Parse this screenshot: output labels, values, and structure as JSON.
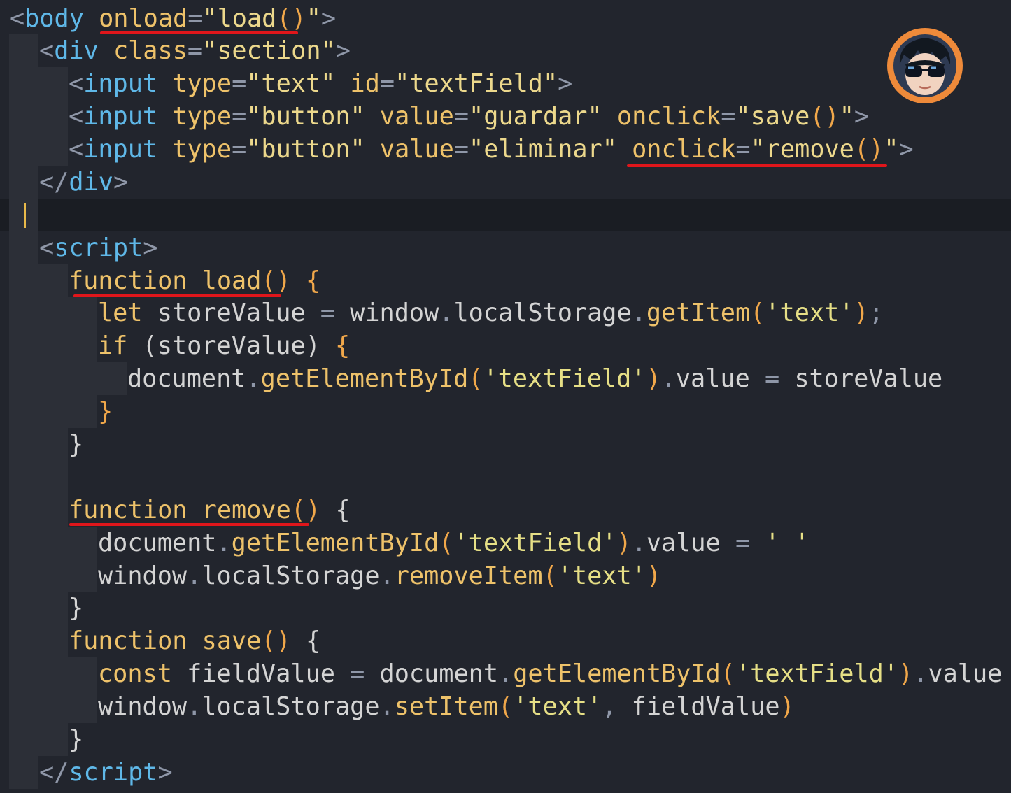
{
  "editor": {
    "lines": [
      [
        [
          "t-punct",
          "<"
        ],
        [
          "t-tag",
          "body"
        ],
        [
          "t-id",
          " "
        ],
        [
          "t-attr",
          "onload"
        ],
        [
          "t-punct",
          "="
        ],
        [
          "t-strb",
          "\"load"
        ],
        [
          "t-paren",
          "()"
        ],
        [
          "t-strb",
          "\""
        ],
        [
          "t-punct",
          ">"
        ]
      ],
      [
        [
          "t-punct",
          "<"
        ],
        [
          "t-tag",
          "div"
        ],
        [
          "t-id",
          " "
        ],
        [
          "t-attr",
          "class"
        ],
        [
          "t-punct",
          "="
        ],
        [
          "t-strb",
          "\"section\""
        ],
        [
          "t-punct",
          ">"
        ]
      ],
      [
        [
          "t-punct",
          "<"
        ],
        [
          "t-tag",
          "input"
        ],
        [
          "t-id",
          " "
        ],
        [
          "t-attr",
          "type"
        ],
        [
          "t-punct",
          "="
        ],
        [
          "t-strb",
          "\"text\""
        ],
        [
          "t-id",
          " "
        ],
        [
          "t-attr",
          "id"
        ],
        [
          "t-punct",
          "="
        ],
        [
          "t-strb",
          "\"textField\""
        ],
        [
          "t-punct",
          ">"
        ]
      ],
      [
        [
          "t-punct",
          "<"
        ],
        [
          "t-tag",
          "input"
        ],
        [
          "t-id",
          " "
        ],
        [
          "t-attr",
          "type"
        ],
        [
          "t-punct",
          "="
        ],
        [
          "t-strb",
          "\"button\""
        ],
        [
          "t-id",
          " "
        ],
        [
          "t-attr",
          "value"
        ],
        [
          "t-punct",
          "="
        ],
        [
          "t-strb",
          "\"guardar\""
        ],
        [
          "t-id",
          " "
        ],
        [
          "t-attr",
          "onclick"
        ],
        [
          "t-punct",
          "="
        ],
        [
          "t-strb",
          "\"save"
        ],
        [
          "t-paren",
          "()"
        ],
        [
          "t-strb",
          "\""
        ],
        [
          "t-punct",
          ">"
        ]
      ],
      [
        [
          "t-punct",
          "<"
        ],
        [
          "t-tag",
          "input"
        ],
        [
          "t-id",
          " "
        ],
        [
          "t-attr",
          "type"
        ],
        [
          "t-punct",
          "="
        ],
        [
          "t-strb",
          "\"button\""
        ],
        [
          "t-id",
          " "
        ],
        [
          "t-attr",
          "value"
        ],
        [
          "t-punct",
          "="
        ],
        [
          "t-strb",
          "\"eliminar\""
        ],
        [
          "t-id",
          " "
        ],
        [
          "t-attr",
          "onclick"
        ],
        [
          "t-punct",
          "="
        ],
        [
          "t-strb",
          "\"remove"
        ],
        [
          "t-paren",
          "()"
        ],
        [
          "t-strb",
          "\""
        ],
        [
          "t-punct",
          ">"
        ]
      ],
      [
        [
          "t-punct",
          "</"
        ],
        [
          "t-tag",
          "div"
        ],
        [
          "t-punct",
          ">"
        ]
      ],
      [],
      [
        [
          "t-punct",
          "<"
        ],
        [
          "t-tag",
          "script"
        ],
        [
          "t-punct",
          ">"
        ]
      ],
      [
        [
          "t-kw",
          "function"
        ],
        [
          "t-id",
          " "
        ],
        [
          "t-fn",
          "load"
        ],
        [
          "t-paren",
          "()"
        ],
        [
          "t-id",
          " "
        ],
        [
          "t-paren",
          "{"
        ]
      ],
      [
        [
          "t-kw",
          "let"
        ],
        [
          "t-id",
          " storeValue "
        ],
        [
          "t-op",
          "="
        ],
        [
          "t-id",
          " window"
        ],
        [
          "t-op",
          "."
        ],
        [
          "t-id",
          "localStorage"
        ],
        [
          "t-op",
          "."
        ],
        [
          "t-method",
          "getItem"
        ],
        [
          "t-paren",
          "("
        ],
        [
          "t-sstr",
          "'text'"
        ],
        [
          "t-paren",
          ")"
        ],
        [
          "t-op",
          ";"
        ]
      ],
      [
        [
          "t-kw",
          "if"
        ],
        [
          "t-id",
          " (storeValue) "
        ],
        [
          "t-paren",
          "{"
        ]
      ],
      [
        [
          "t-id",
          "document"
        ],
        [
          "t-op",
          "."
        ],
        [
          "t-method",
          "getElementById"
        ],
        [
          "t-paren",
          "("
        ],
        [
          "t-sstr",
          "'textField'"
        ],
        [
          "t-paren",
          ")"
        ],
        [
          "t-op",
          "."
        ],
        [
          "t-id",
          "value "
        ],
        [
          "t-op",
          "="
        ],
        [
          "t-id",
          " storeValue"
        ]
      ],
      [
        [
          "t-paren",
          "}"
        ]
      ],
      [
        [
          "t-id",
          "}"
        ]
      ],
      [],
      [
        [
          "t-kw",
          "function"
        ],
        [
          "t-id",
          " "
        ],
        [
          "t-fn",
          "remove"
        ],
        [
          "t-paren",
          "()"
        ],
        [
          "t-id",
          " "
        ],
        [
          "t-id",
          "{"
        ]
      ],
      [
        [
          "t-id",
          "document"
        ],
        [
          "t-op",
          "."
        ],
        [
          "t-method",
          "getElementById"
        ],
        [
          "t-paren",
          "("
        ],
        [
          "t-sstr",
          "'textField'"
        ],
        [
          "t-paren",
          ")"
        ],
        [
          "t-op",
          "."
        ],
        [
          "t-id",
          "value "
        ],
        [
          "t-op",
          "="
        ],
        [
          "t-id",
          " "
        ],
        [
          "t-sstr",
          "' '"
        ]
      ],
      [
        [
          "t-id",
          "window"
        ],
        [
          "t-op",
          "."
        ],
        [
          "t-id",
          "localStorage"
        ],
        [
          "t-op",
          "."
        ],
        [
          "t-method",
          "removeItem"
        ],
        [
          "t-paren",
          "("
        ],
        [
          "t-sstr",
          "'text'"
        ],
        [
          "t-paren",
          ")"
        ]
      ],
      [
        [
          "t-id",
          "}"
        ]
      ],
      [
        [
          "t-kw",
          "function"
        ],
        [
          "t-id",
          " "
        ],
        [
          "t-fn",
          "save"
        ],
        [
          "t-paren",
          "()"
        ],
        [
          "t-id",
          " "
        ],
        [
          "t-id",
          "{"
        ]
      ],
      [
        [
          "t-kw",
          "const"
        ],
        [
          "t-id",
          " fieldValue "
        ],
        [
          "t-op",
          "="
        ],
        [
          "t-id",
          " document"
        ],
        [
          "t-op",
          "."
        ],
        [
          "t-method",
          "getElementById"
        ],
        [
          "t-paren",
          "("
        ],
        [
          "t-sstr",
          "'textField'"
        ],
        [
          "t-paren",
          ")"
        ],
        [
          "t-op",
          "."
        ],
        [
          "t-id",
          "value"
        ]
      ],
      [
        [
          "t-id",
          "window"
        ],
        [
          "t-op",
          "."
        ],
        [
          "t-id",
          "localStorage"
        ],
        [
          "t-op",
          "."
        ],
        [
          "t-method",
          "setItem"
        ],
        [
          "t-paren",
          "("
        ],
        [
          "t-sstr",
          "'text'"
        ],
        [
          "t-op",
          ","
        ],
        [
          "t-id",
          " fieldValue"
        ],
        [
          "t-paren",
          ")"
        ]
      ],
      [
        [
          "t-id",
          "}"
        ]
      ],
      [
        [
          "t-punct",
          "</"
        ],
        [
          "t-tag",
          "script"
        ],
        [
          "t-punct",
          ">"
        ]
      ]
    ],
    "current_line": 7
  },
  "colors": {
    "background": "#22252d",
    "current_line": "#1a1d23",
    "indent_guide": "#2c2f37",
    "caret": "#e8b94a",
    "annotation_underline": "#e0161b",
    "avatar_ring": "#ee8a3a"
  },
  "avatar": {
    "icon": "cartoon-avatar-with-sunglasses-icon"
  }
}
